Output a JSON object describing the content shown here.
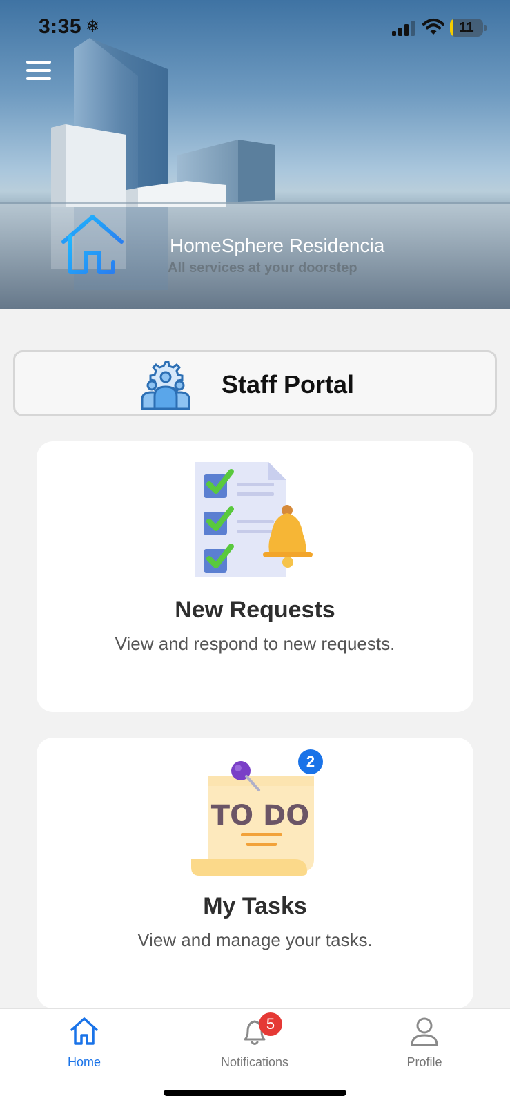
{
  "status_bar": {
    "time": "3:35",
    "time_glyph": "❄",
    "battery_level": "11",
    "battery_fraction": 0.11,
    "icons": [
      "signal-bars-icon",
      "wifi-icon",
      "battery-icon"
    ]
  },
  "header": {
    "menu_icon": "hamburger-menu-icon",
    "brand_icon": "house-outline-icon",
    "brand_title": "HomeSphere Residencia",
    "tagline": "All services at your doorstep"
  },
  "portal": {
    "icon": "team-gear-icon",
    "title": "Staff Portal"
  },
  "cards": [
    {
      "icon": "checklist-bell-icon",
      "title": "New Requests",
      "description": "View and respond to new requests."
    },
    {
      "icon": "todo-note-icon",
      "illustration_text": "TO DO",
      "badge": "2",
      "title": "My Tasks",
      "description": "View and manage your tasks."
    }
  ],
  "tab_bar": {
    "active": "Home",
    "tabs": [
      {
        "label": "Home",
        "icon": "home-icon",
        "badge": ""
      },
      {
        "label": "Notifications",
        "icon": "bell-icon",
        "badge": "5"
      },
      {
        "label": "Profile",
        "icon": "person-icon",
        "badge": ""
      }
    ]
  },
  "colors": {
    "accent": "#1a73e8",
    "badge_red": "#e53935",
    "brand_icon": "#29a8f0",
    "page_background": "#f2f2f2"
  }
}
